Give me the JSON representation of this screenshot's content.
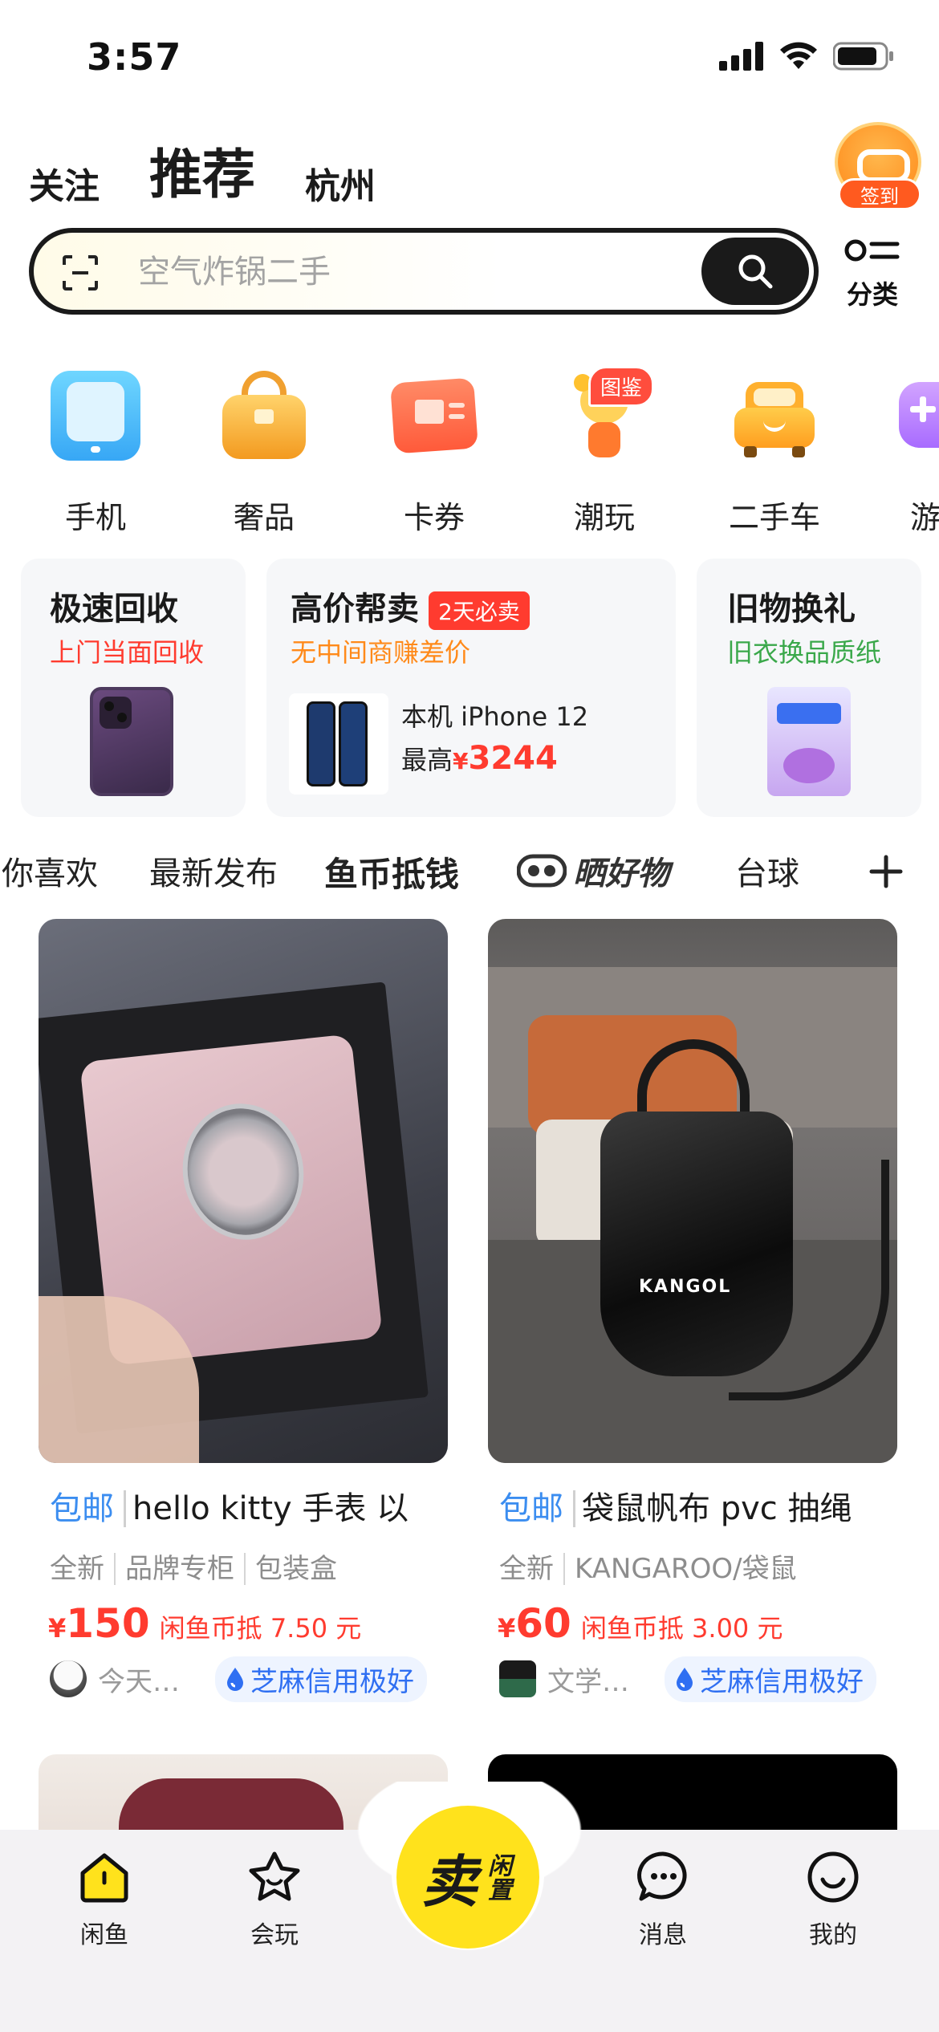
{
  "status": {
    "time": "3:57"
  },
  "top_tabs": [
    {
      "label": "关注"
    },
    {
      "label": "推荐"
    },
    {
      "label": "杭州"
    }
  ],
  "checkin": {
    "label": "签到"
  },
  "search": {
    "placeholder": "空气炸锅二手"
  },
  "category_entry": {
    "label": "分类"
  },
  "categories": [
    {
      "label": "手机",
      "icon": "phone-icon"
    },
    {
      "label": "奢品",
      "icon": "handbag-icon"
    },
    {
      "label": "卡券",
      "icon": "coupon-icon"
    },
    {
      "label": "潮玩",
      "icon": "toy-icon",
      "badge": "图鉴"
    },
    {
      "label": "二手车",
      "icon": "car-icon"
    },
    {
      "label": "游",
      "icon": "game-icon"
    }
  ],
  "promos": [
    {
      "title": "极速回收",
      "subtitle": "上门当面回收",
      "subtitle_color": "#ff3b2f"
    },
    {
      "title": "高价帮卖",
      "badge": "2天必卖",
      "subtitle": "无中间商赚差价",
      "subtitle_color": "#ff8a1a",
      "device": "本机 iPhone 12",
      "price_label": "最高",
      "price_currency": "¥",
      "price": "3244"
    },
    {
      "title": "旧物换礼",
      "subtitle": "旧衣换品质纸",
      "subtitle_color": "#3aa84a"
    }
  ],
  "feed_tabs": [
    {
      "label": "你喜欢"
    },
    {
      "label": "最新发布"
    },
    {
      "label": "鱼币抵钱"
    },
    {
      "label": "晒好物"
    },
    {
      "label": "台球"
    }
  ],
  "products": [
    {
      "free_shipping": "包邮",
      "title": "hello kitty 手表 以",
      "tags": [
        "全新",
        "品牌专柜",
        "包装盒"
      ],
      "currency": "¥",
      "price": "150",
      "coin_text": "闲鱼币抵 7.50 元",
      "seller": "今天…",
      "credit": "芝麻信用极好"
    },
    {
      "free_shipping": "包邮",
      "title": "袋鼠帆布 pvc 抽绳",
      "tags": [
        "全新",
        "KANGAROO/袋鼠"
      ],
      "currency": "¥",
      "price": "60",
      "coin_text": "闲鱼币抵 3.00 元",
      "seller": "文学…",
      "credit": "芝麻信用极好",
      "image_text": "KANGOL"
    }
  ],
  "bottom_nav": [
    {
      "label": "闲鱼"
    },
    {
      "label": "会玩"
    },
    {
      "label": "消息"
    },
    {
      "label": "我的"
    }
  ],
  "sell_button": {
    "big": "卖",
    "small": "闲置"
  },
  "colors": {
    "brand_yellow": "#ffe21c",
    "price_red": "#ff3b2f",
    "link_blue": "#3b8df0"
  }
}
